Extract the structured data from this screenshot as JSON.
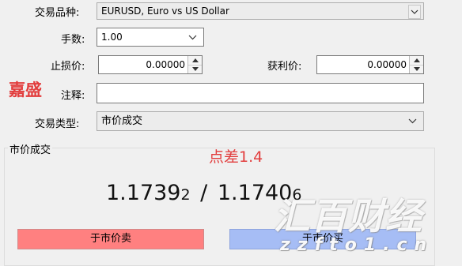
{
  "form": {
    "symbol_label": "交易品种:",
    "symbol_value": "EURUSD, Euro vs US Dollar",
    "volume_label": "手数:",
    "volume_value": "1.00",
    "stop_loss_label": "止损价:",
    "stop_loss_value": "0.00000",
    "take_profit_label": "获利价:",
    "take_profit_value": "0.00000",
    "comment_label": "注释:",
    "comment_value": "",
    "order_type_label": "交易类型:",
    "order_type_value": "市价成交"
  },
  "market": {
    "group_title": "市价成交",
    "bid_main": "1.1739",
    "bid_small": "2",
    "separator": "/",
    "ask_main": "1.1740",
    "ask_small": "6",
    "sell_label": "于市价卖",
    "buy_label": "于市价买"
  },
  "overlays": {
    "brand_left": "嘉盛",
    "spread_label": "点差1.4",
    "watermark_cn": "汇百财经",
    "watermark_url": "zzfto1.cn"
  },
  "colors": {
    "sell_button": "#ff8080",
    "buy_button": "#a6bdf5",
    "annotation_red": "#e23d3d"
  }
}
